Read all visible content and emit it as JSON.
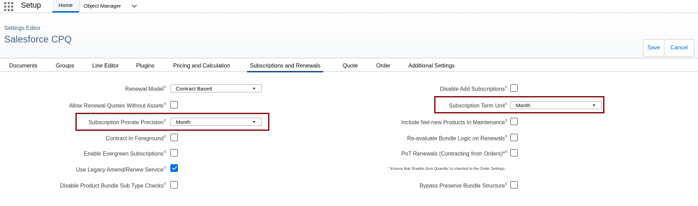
{
  "topbar": {
    "app_name": "Setup",
    "tabs": [
      "Home",
      "Object Manager"
    ]
  },
  "header": {
    "breadcrumb": "Settings Editor",
    "title": "Salesforce CPQ",
    "save_label": "Save",
    "cancel_label": "Cancel"
  },
  "tabs": [
    "Documents",
    "Groups",
    "Line Editor",
    "Plugins",
    "Pricing and Calculation",
    "Subscriptions and Renewals",
    "Quote",
    "Order",
    "Additional Settings"
  ],
  "active_tab": "Subscriptions and Renewals",
  "left": {
    "renewal_model": {
      "label": "Renewal Model",
      "value": "Contract Based"
    },
    "allow_renewal_quotes": {
      "label": "Allow Renewal Quotes Without Assets",
      "checked": false
    },
    "prorate_precision": {
      "label": "Subscription Prorate Precision",
      "value": "Month"
    },
    "contract_foreground": {
      "label": "Contract In Foreground",
      "checked": false
    },
    "evergreen": {
      "label": "Enable Evergreen Subscriptions",
      "checked": false
    },
    "legacy_amend": {
      "label": "Use Legacy Amend/Renew Service",
      "checked": true
    },
    "disable_bundle_checks": {
      "label": "Disable Product Bundle Sub Type Checks",
      "checked": false
    }
  },
  "right": {
    "disable_add_subs": {
      "label": "Disable Add Subscriptions",
      "checked": false
    },
    "term_unit": {
      "label": "Subscription Term Unit",
      "value": "Month"
    },
    "net_new": {
      "label": "Include Net-new Products In Maintenance",
      "checked": false
    },
    "reevaluate": {
      "label": "Re-evaluate Bundle Logic on Renewals",
      "checked": false
    },
    "pot_renewals": {
      "label": "PoT Renewals (Contracting from Orders)*",
      "checked": false
    },
    "note": "* Ensure that 'Enable Zero Quantity' is checked in the Order Settings.",
    "bypass": {
      "label": "Bypass Preserve Bundle Structure",
      "checked": false
    }
  },
  "info_glyph": "®",
  "highlight_color": "#8b2023"
}
